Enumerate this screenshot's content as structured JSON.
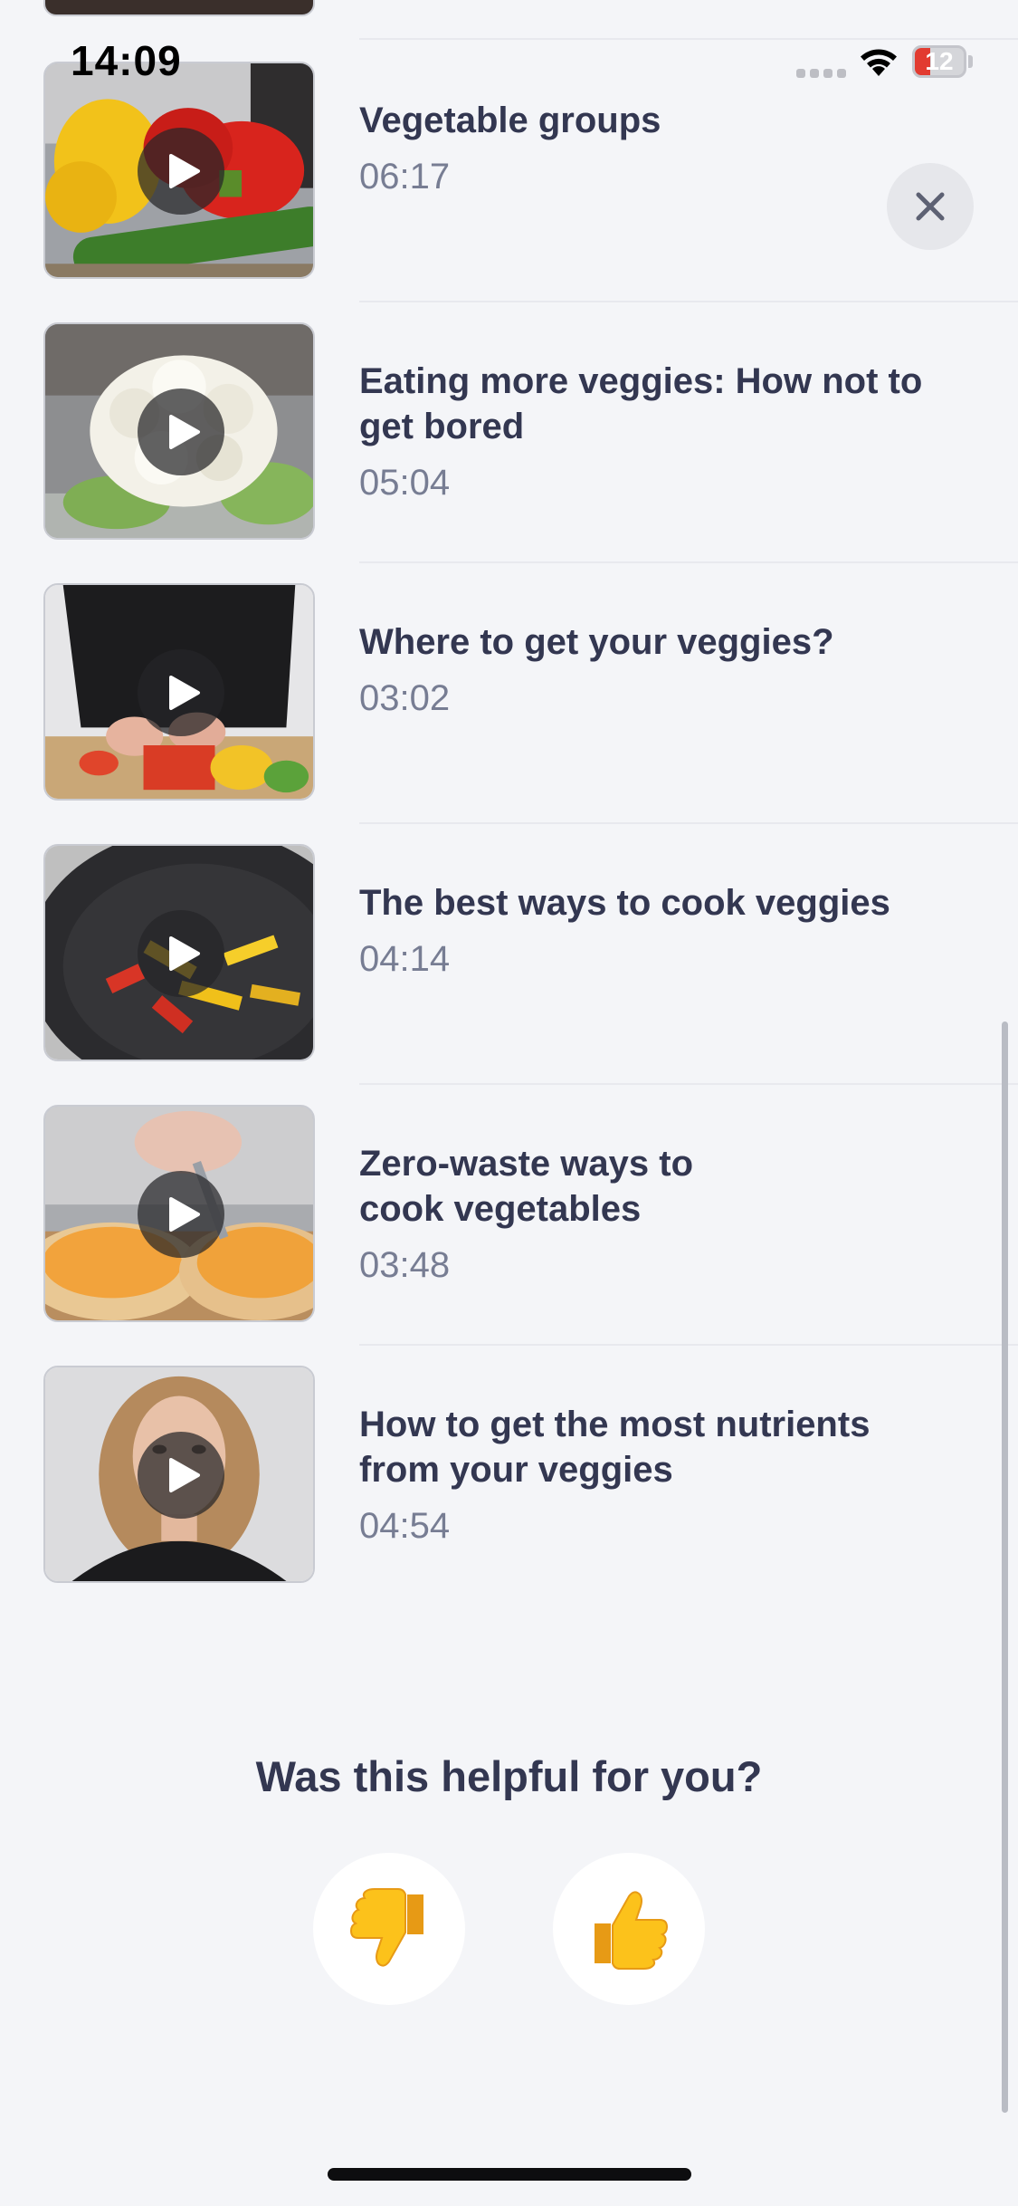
{
  "status_bar": {
    "time": "14:09",
    "battery_level": "12"
  },
  "close_icon": "close-icon",
  "videos": [
    {
      "title": "Vegetable groups",
      "duration": "06:17"
    },
    {
      "title": "Eating more veggies: How not to get bored",
      "duration": "05:04"
    },
    {
      "title": "Where to get your veggies?",
      "duration": "03:02"
    },
    {
      "title": "The best ways to cook veggies",
      "duration": "04:14"
    },
    {
      "title": "Zero-waste ways to cook vegetables",
      "duration": "03:48"
    },
    {
      "title": "How to get the most nutrients from your veggies",
      "duration": "04:54"
    }
  ],
  "feedback": {
    "question": "Was this helpful for you?",
    "thumbs_down_icon": "thumbs-down-icon",
    "thumbs_up_icon": "thumbs-up-icon"
  },
  "colors": {
    "accent_text": "#333751",
    "secondary_text": "#777d93",
    "background": "#f4f5f8"
  }
}
